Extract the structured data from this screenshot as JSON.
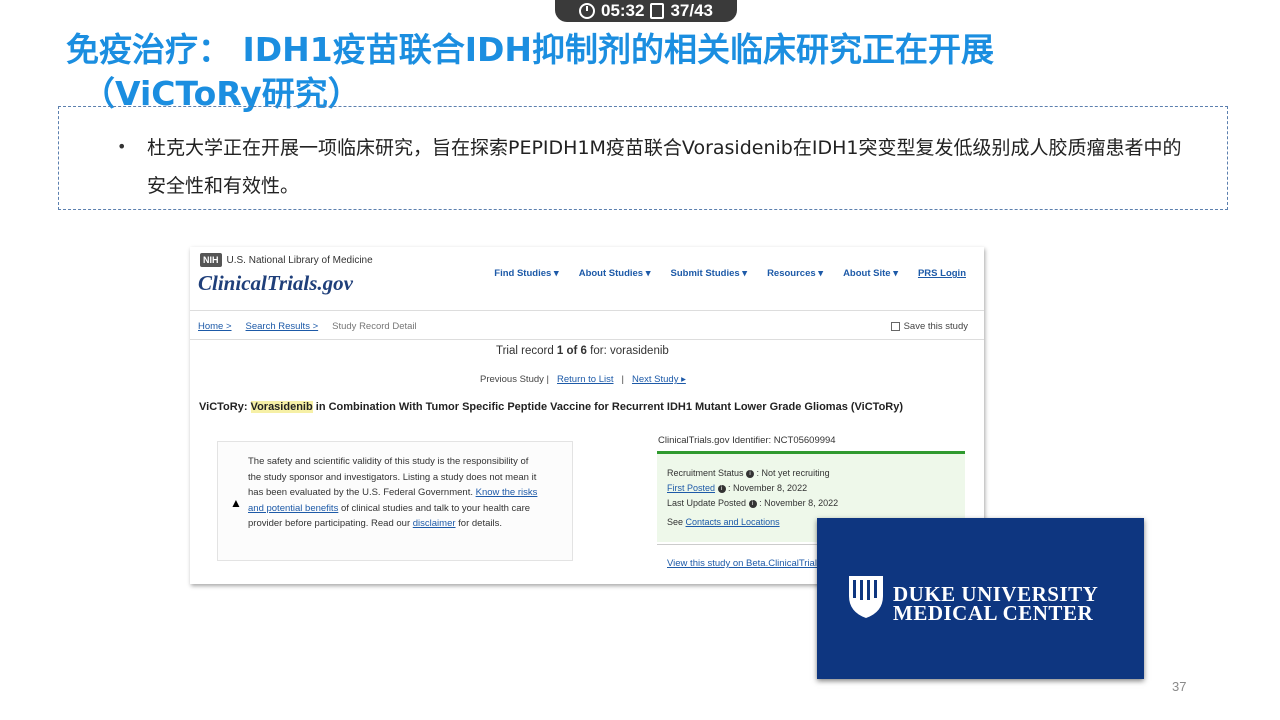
{
  "overlay": {
    "time": "05:32",
    "counter": "37/43"
  },
  "slide": {
    "title_line1": "免疫治疗： IDH1疫苗联合IDH抑制剂的相关临床研究正在开展",
    "title_line2": "（ViCToRy研究）",
    "bullet_mark": "•",
    "bullet_text": "杜克大学正在开展一项临床研究，旨在探索PEPIDH1M疫苗联合Vorasidenib在IDH1突变型复发低级别成人胶质瘤患者中的安全性和有效性。",
    "page_number": "37"
  },
  "ctgov": {
    "nih_badge": "NIH",
    "nlm": "U.S. National Library of Medicine",
    "brand": "ClinicalTrials.gov",
    "nav": [
      "Find Studies ▾",
      "About Studies ▾",
      "Submit Studies ▾",
      "Resources ▾",
      "About Site ▾",
      "PRS Login"
    ],
    "crumbs": [
      "Home >",
      "Search Results >",
      "Study Record Detail"
    ],
    "save": "Save this study",
    "record_prefix": "Trial record ",
    "record_bold": "1 of 6",
    "record_suffix": " for:    vorasidenib",
    "prev": "Previous Study |",
    "return": "Return to List",
    "sep": "|",
    "next": "Next Study ▸",
    "title_pre": "ViCToRy: ",
    "title_hl": "Vorasidenib",
    "title_post": " in Combination With Tumor Specific Peptide Vaccine for Recurrent IDH1 Mutant Lower Grade Gliomas (ViCToRy)",
    "notice_a": "The safety and scientific validity of this study is the responsibility of the study sponsor and investigators. Listing a study does not mean it has been evaluated by the U.S. Federal Government. ",
    "notice_link1": "Know the risks and potential benefits",
    "notice_b": " of clinical studies and talk to your health care provider before participating. Read our ",
    "notice_link2": "disclaimer",
    "notice_c": " for details.",
    "identifier": "ClinicalTrials.gov Identifier: NCT05609994",
    "recruit_label": "Recruitment Status",
    "recruit_value": " : Not yet recruiting",
    "first_label": "First Posted",
    "first_value": " : November 8, 2022",
    "update_label": "Last Update Posted",
    "update_value": " : November 8, 2022",
    "see": "See ",
    "contacts": "Contacts and Locations",
    "beta": "View this study on Beta.ClinicalTrials.gov"
  },
  "duke": {
    "line1": "DUKE UNIVERSITY",
    "line2": "MEDICAL CENTER"
  }
}
